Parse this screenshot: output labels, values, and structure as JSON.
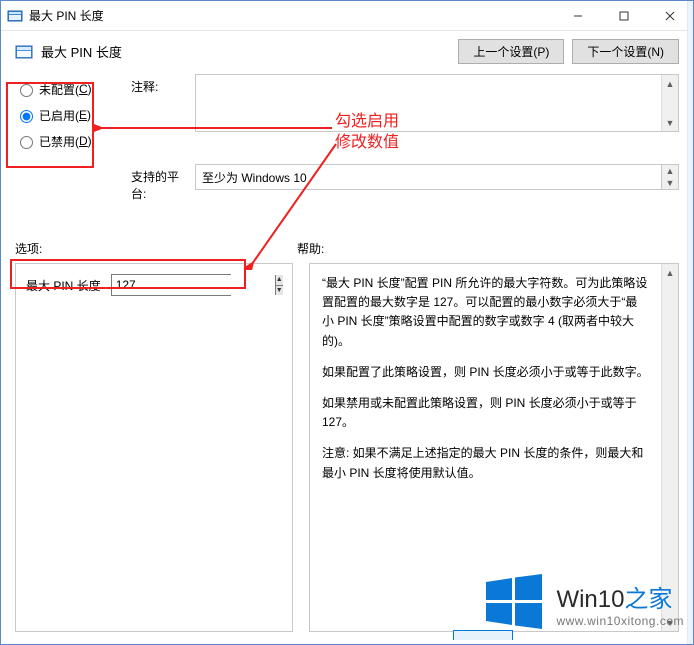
{
  "titlebar": {
    "title": "最大 PIN 长度"
  },
  "header": {
    "title": "最大 PIN 长度",
    "prev_btn": "上一个设置(P)",
    "next_btn": "下一个设置(N)"
  },
  "radios": {
    "not_configured": {
      "label_pre": "未配置(",
      "hotkey": "C",
      "label_post": ")"
    },
    "enabled": {
      "label_pre": "已启用(",
      "hotkey": "E",
      "label_post": ")"
    },
    "disabled": {
      "label_pre": "已禁用(",
      "hotkey": "D",
      "label_post": ")"
    },
    "selected": "enabled"
  },
  "comment": {
    "label": "注释:",
    "value": ""
  },
  "platform": {
    "label": "支持的平台:",
    "value": "至少为 Windows 10"
  },
  "sections": {
    "options": "选项:",
    "help": "帮助:"
  },
  "option": {
    "label": "最大 PIN 长度",
    "value": "127"
  },
  "help": {
    "p1": "“最大 PIN 长度”配置 PIN 所允许的最大字符数。可为此策略设置配置的最大数字是 127。可以配置的最小数字必须大于“最小 PIN 长度”策略设置中配置的数字或数字 4 (取两者中较大的)。",
    "p2": "如果配置了此策略设置，则 PIN 长度必须小于或等于此数字。",
    "p3": "如果禁用或未配置此策略设置，则 PIN 长度必须小于或等于 127。",
    "p4": "注意: 如果不满足上述指定的最大 PIN 长度的条件，则最大和最小 PIN 长度将使用默认值。"
  },
  "annotation": {
    "line1": "勾选启用",
    "line2": "修改数值"
  },
  "watermark": {
    "brand_pre": "Win10",
    "brand_post": "之家",
    "url": "www.win10xitong.com"
  }
}
